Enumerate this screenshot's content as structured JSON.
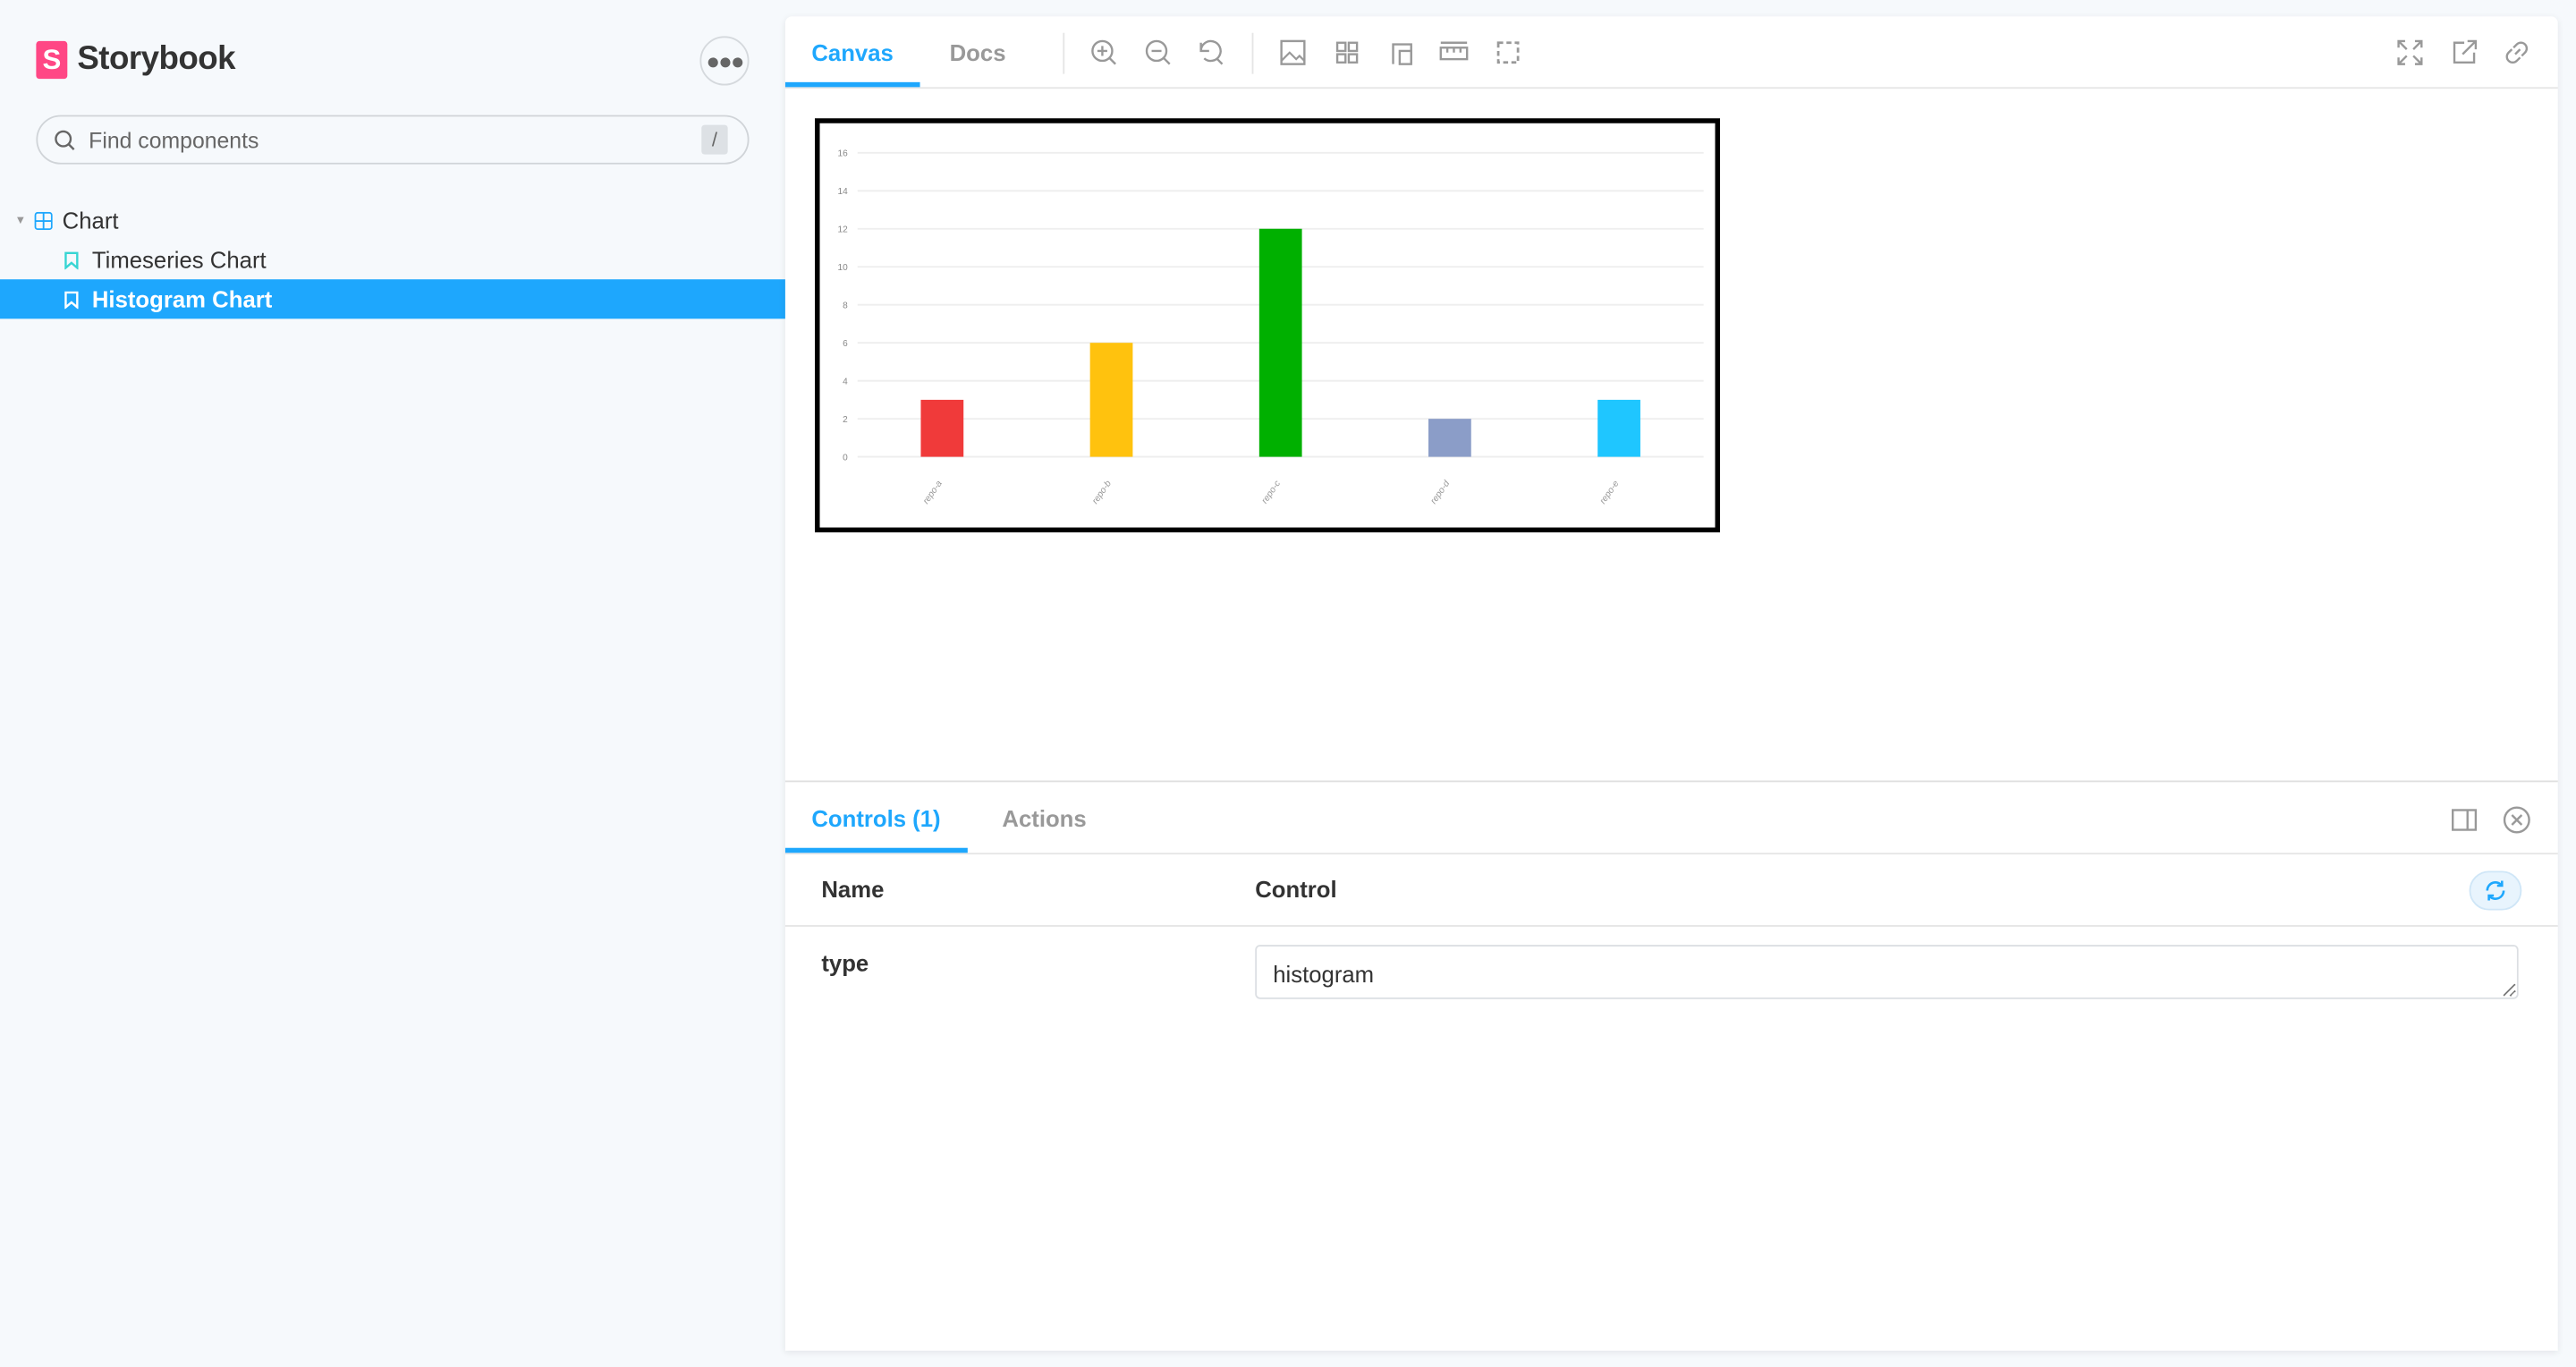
{
  "app": {
    "name": "Storybook",
    "logo_letter": "S",
    "brand_color": "#ff4785",
    "accent_color": "#1ea7fd"
  },
  "sidebar": {
    "more_icon": "ellipsis-icon",
    "search": {
      "placeholder": "Find components",
      "shortcut": "/"
    },
    "tree": [
      {
        "label": "Chart",
        "icon": "component-grid-icon",
        "expanded": true
      },
      {
        "label": "Timeseries Chart",
        "icon": "bookmark-icon",
        "selected": false
      },
      {
        "label": "Histogram Chart",
        "icon": "bookmark-icon",
        "selected": true
      }
    ]
  },
  "toolbar": {
    "tabs": [
      {
        "label": "Canvas",
        "active": true
      },
      {
        "label": "Docs",
        "active": false
      }
    ],
    "tools": [
      "zoom-in-icon",
      "zoom-out-icon",
      "reset-zoom-icon",
      "background-icon",
      "grid-icon",
      "viewport-icon",
      "measure-icon",
      "outline-icon"
    ],
    "right_tools": [
      "fullscreen-icon",
      "open-new-tab-icon",
      "copy-link-icon"
    ]
  },
  "addons": {
    "tabs": [
      {
        "label": "Controls (1)",
        "active": true
      },
      {
        "label": "Actions",
        "active": false
      }
    ],
    "table": {
      "name_header": "Name",
      "control_header": "Control",
      "rows": [
        {
          "name": "type",
          "value": "histogram"
        }
      ]
    }
  },
  "chart_data": {
    "type": "bar",
    "categories": [
      "repo-a",
      "repo-b",
      "repo-c",
      "repo-d",
      "repo-e"
    ],
    "values": [
      3,
      6,
      12,
      2,
      3
    ],
    "colors": [
      "#f03a3a",
      "#ffc20e",
      "#00b000",
      "#8b9dc8",
      "#1fc6ff"
    ],
    "ylim": [
      0,
      16
    ],
    "yticks": [
      0,
      2,
      4,
      6,
      8,
      10,
      12,
      14,
      16
    ],
    "grid": true,
    "legend": "none"
  }
}
